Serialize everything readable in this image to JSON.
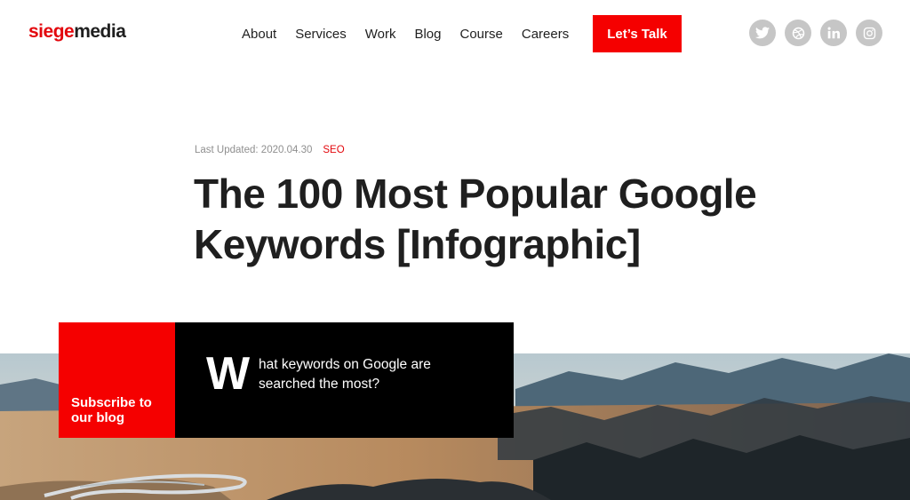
{
  "logo": {
    "part1": "siege",
    "part2": "media"
  },
  "nav": {
    "items": [
      "About",
      "Services",
      "Work",
      "Blog",
      "Course",
      "Careers"
    ]
  },
  "cta": {
    "label": "Let’s Talk"
  },
  "social": [
    "twitter-icon",
    "dribbble-icon",
    "linkedin-icon",
    "instagram-icon"
  ],
  "article": {
    "meta_label": "Last Updated: 2020.04.30",
    "category": "SEO",
    "title": "The 100 Most Popular Google Keywords [Infographic]"
  },
  "subscribe": {
    "label": "Subscribe to our blog"
  },
  "intro": {
    "dropcap": "W",
    "text": "hat keywords on Google are searched the most?"
  },
  "colors": {
    "brand_red": "#f50000",
    "dark": "#1f1f1f",
    "social_grey": "#c6c6c6"
  }
}
